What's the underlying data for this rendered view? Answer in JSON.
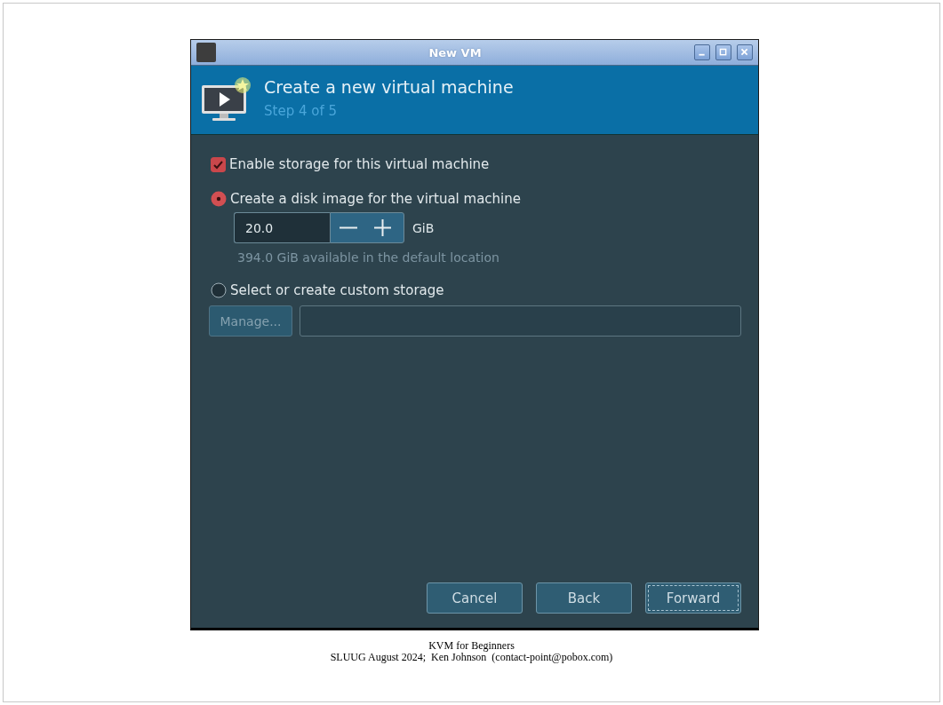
{
  "window": {
    "title": "New VM"
  },
  "header": {
    "title": "Create a new virtual machine",
    "step": "Step 4 of 5"
  },
  "enable_storage": {
    "label": "Enable storage for this virtual machine",
    "checked": true
  },
  "storage_options": [
    {
      "kind": "disk-image",
      "label": "Create a disk image for the virtual machine",
      "selected": true
    },
    {
      "kind": "custom",
      "label": "Select or create custom storage",
      "selected": false
    }
  ],
  "disk_size": {
    "value": "20.0",
    "unit": "GiB",
    "available": "394.0 GiB available in the default location"
  },
  "manage_button": {
    "label": "Manage...",
    "disabled": true
  },
  "buttons": [
    {
      "label": "Cancel",
      "focused": false
    },
    {
      "label": "Back",
      "focused": false
    },
    {
      "label": "Forward",
      "focused": true
    }
  ],
  "footer": [
    "KVM for Beginners",
    "SLUUG August 2024;  Ken Johnson  (contact-point@pobox.com)"
  ]
}
